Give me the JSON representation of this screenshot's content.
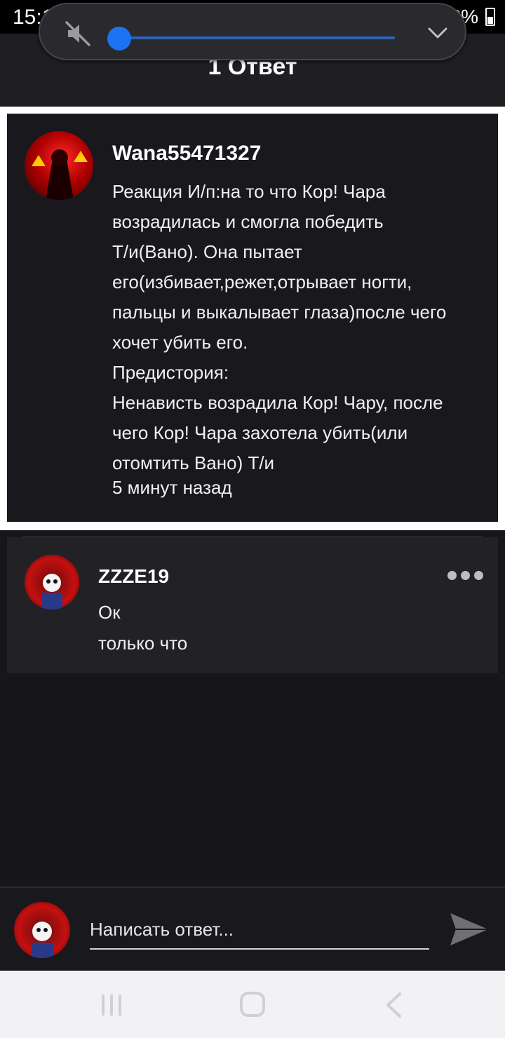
{
  "status_bar": {
    "time": "15:12",
    "notif_icons": "W W",
    "battery": "48%"
  },
  "header": {
    "title": "1 Ответ"
  },
  "volume_panel": {
    "muted": true,
    "level": 0.0
  },
  "main_comment": {
    "author": "Wana55471327",
    "text": "Реакция И/п:на то что Кор! Чара\nвозрадилась и смогла победить\nТ/и(Вано). Она пытает\nего(избивает,режет,отрывает ногти,\nпальцы и выкалывает глаза)после чего\nхочет убить его.\nПредистория:\nНенависть возрадила Кор! Чару, после\nчего Кор! Чара захотела убить(или\nотомтить Вано) Т/и",
    "time": "5 минут назад"
  },
  "reply": {
    "author": "ZZZE19",
    "text": "Ок",
    "time": "только что"
  },
  "input_bar": {
    "placeholder": "Написать ответ..."
  },
  "colors": {
    "accent": "#1a73f0",
    "background": "#17161b",
    "card": "#19181d",
    "reply_card": "#222126"
  },
  "icons": {
    "mute": "volume-mute-icon",
    "chevron": "chevron-down-icon",
    "more": "more-horizontal-icon",
    "send": "send-icon",
    "recents": "recents-icon",
    "home": "home-icon",
    "back": "back-icon"
  }
}
